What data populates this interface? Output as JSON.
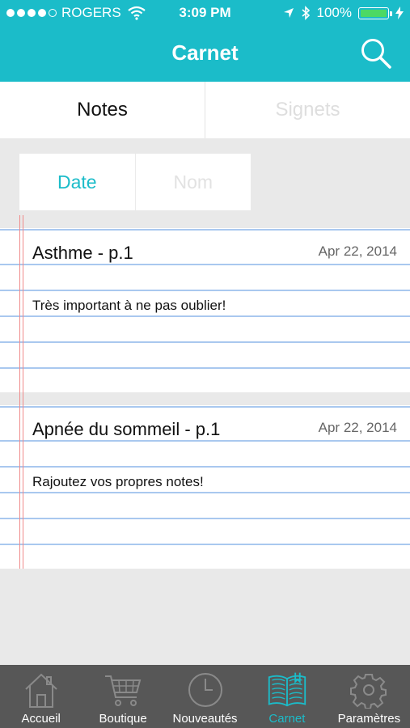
{
  "status": {
    "carrier": "ROGERS",
    "time": "3:09 PM",
    "battery": "100%"
  },
  "nav": {
    "title": "Carnet"
  },
  "tabs": [
    {
      "label": "Notes",
      "active": true
    },
    {
      "label": "Signets",
      "active": false
    }
  ],
  "sort": [
    {
      "label": "Date",
      "active": true
    },
    {
      "label": "Nom",
      "active": false
    }
  ],
  "notes": [
    {
      "title": "Asthme - p.1",
      "date": "Apr 22, 2014",
      "body": "Très important à ne pas oublier!"
    },
    {
      "title": "Apnée du sommeil - p.1",
      "date": "Apr 22, 2014",
      "body": "Rajoutez vos propres notes!"
    }
  ],
  "tabbar": [
    {
      "label": "Accueil",
      "icon": "home-icon"
    },
    {
      "label": "Boutique",
      "icon": "cart-icon"
    },
    {
      "label": "Nouveautés",
      "icon": "clock-icon"
    },
    {
      "label": "Carnet",
      "icon": "book-icon",
      "active": true
    },
    {
      "label": "Paramètres",
      "icon": "gear-icon"
    }
  ],
  "colors": {
    "accent": "#1bbcc9",
    "tabbar": "#575757",
    "rule": "#a9c8ef",
    "margin": "#f08a8a"
  }
}
